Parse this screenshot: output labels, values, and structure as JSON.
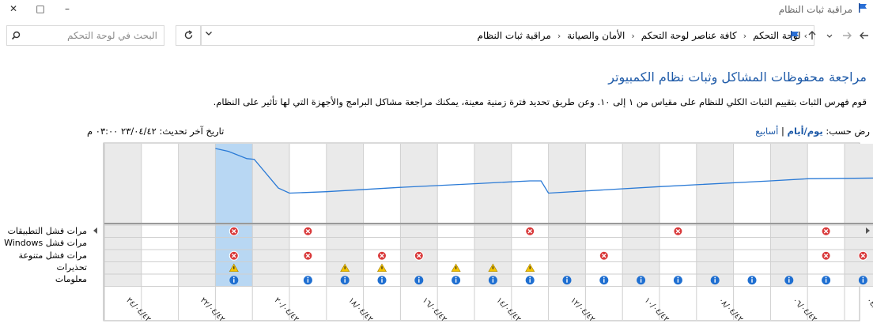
{
  "window": {
    "title": "مراقبة ثبات النظام",
    "minimize_glyph": "–",
    "maximize_glyph": "□",
    "close_glyph": "✕"
  },
  "search": {
    "placeholder": "البحث في لوحة التحكم"
  },
  "breadcrumb": [
    "لوحة التحكم",
    "كافة عناصر لوحة التحكم",
    "الأمان والصيانة",
    "مراقبة ثبات النظام"
  ],
  "page": {
    "heading": "مراجعة محفوظات المشاكل وثبات نظام الكمبيوتر",
    "description": "قوم فهرس الثبات بتقييم الثبات الكلي للنظام على مقياس من ١ إلى ١٠. وعن طريق تحديد فترة زمنية معينة، يمكنك مراجعة مشاكل البرامج والأجهزة التي لها تأثير على النظام.",
    "view_by_label": "رض حسب:",
    "view_days": "يوم/أيام",
    "view_separator": "|",
    "view_weeks": "أسابيع",
    "last_updated": "تاريخ آخر تحديث: ٢٣/٠٤/٤٢ ‎٠٣:٠٠ م"
  },
  "row_labels": [
    "مرات فشل التطبيقات",
    "مرات فشل Windows",
    "مرات فشل متنوعة",
    "تحذيرات",
    "معلومات"
  ],
  "chart_data": {
    "type": "line",
    "yticks": [
      "10",
      "5",
      "1"
    ],
    "ylim": [
      1,
      10
    ],
    "selected_column": 3,
    "x_labels": [
      "٢٤/٠٤/٤٢",
      "٢٢/٠٤/٤٢",
      "٢٠/٠٤/٤٢",
      "١٨/٠٤/٤٢",
      "١٦/٠٤/٤٢",
      "١٤/٠٤/٤٢",
      "١٢/٠٤/٤٢",
      "١٠/٠٤/٤٢",
      "٠٨/٠٤/٤٢",
      "٠٦/٠٤/٤٢",
      "٠٤/٠٤/٤٢"
    ],
    "columns": 21,
    "stability_index": [
      [
        3.0,
        10.0
      ],
      [
        3.35,
        9.6
      ],
      [
        3.85,
        8.6
      ],
      [
        4.05,
        8.5
      ],
      [
        4.7,
        4.5
      ],
      [
        5.0,
        3.8
      ],
      [
        6.0,
        4.0
      ],
      [
        8.0,
        4.6
      ],
      [
        10.0,
        5.1
      ],
      [
        11.5,
        5.5
      ],
      [
        11.8,
        5.5
      ],
      [
        12.0,
        3.8
      ],
      [
        15.0,
        4.7
      ],
      [
        18.0,
        5.5
      ],
      [
        19.0,
        5.8
      ],
      [
        20.8,
        5.9
      ],
      [
        21.0,
        5.8
      ]
    ],
    "events": {
      "app_failures": [
        3,
        5,
        11,
        15,
        19
      ],
      "windows_failures": [],
      "misc_failures": [
        3,
        5,
        7,
        8,
        13,
        19,
        20
      ],
      "warnings": [
        3,
        6,
        7,
        9,
        10,
        11
      ],
      "information": [
        3,
        5,
        6,
        7,
        8,
        9,
        10,
        11,
        12,
        13,
        14,
        15,
        16,
        17,
        18,
        19,
        20
      ]
    }
  }
}
